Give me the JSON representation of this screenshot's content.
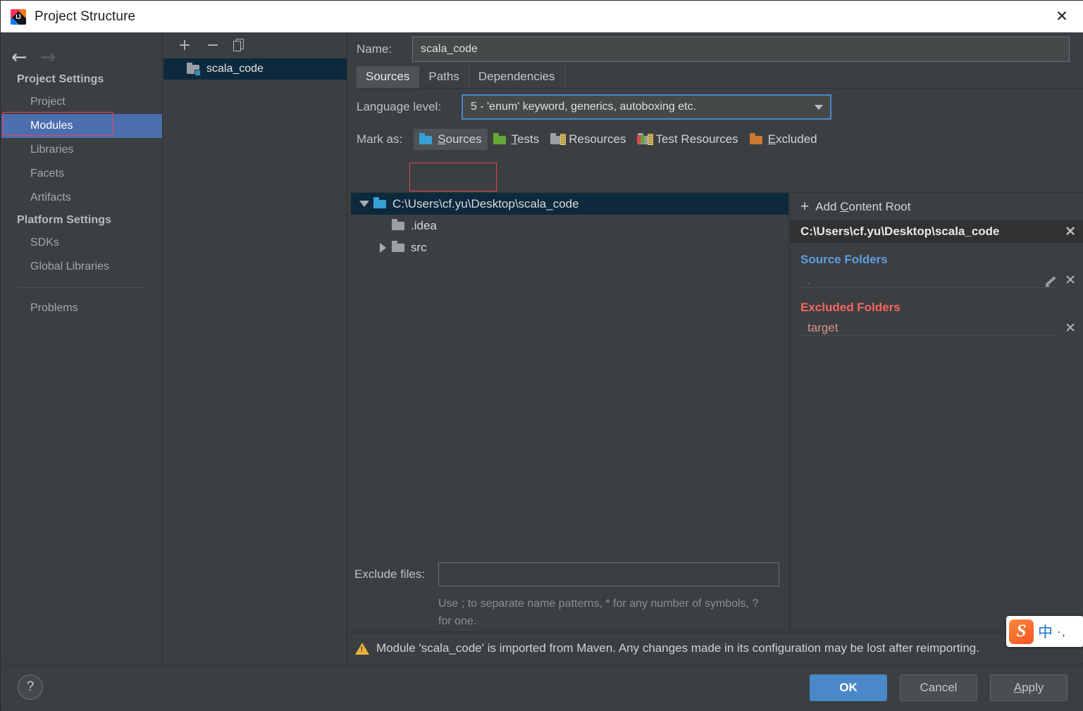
{
  "window": {
    "title": "Project Structure",
    "app_icon": "intellij-idea-icon",
    "close_label": "✕"
  },
  "sidebar": {
    "back_arrow": "←",
    "forward_arrow": "→",
    "groups": [
      {
        "title": "Project Settings",
        "items": [
          {
            "label": "Project",
            "selected": false
          },
          {
            "label": "Modules",
            "selected": true
          },
          {
            "label": "Libraries",
            "selected": false
          },
          {
            "label": "Facets",
            "selected": false
          },
          {
            "label": "Artifacts",
            "selected": false
          }
        ]
      },
      {
        "title": "Platform Settings",
        "items": [
          {
            "label": "SDKs",
            "selected": false
          },
          {
            "label": "Global Libraries",
            "selected": false
          }
        ]
      }
    ],
    "problems": {
      "label": "Problems"
    },
    "highlight_color": "#e8425a"
  },
  "module_panel": {
    "toolbar": {
      "add_label": "+",
      "remove_label": "−",
      "copy_label": "copy-icon"
    },
    "modules": [
      {
        "label": "scala_code",
        "selected": true
      }
    ]
  },
  "main": {
    "name_label": "Name:",
    "name_value": "scala_code",
    "tabs": [
      {
        "label": "Sources",
        "active": true
      },
      {
        "label": "Paths",
        "active": false
      },
      {
        "label": "Dependencies",
        "active": false
      }
    ],
    "language_level": {
      "label": "Language level:",
      "value": "5 - 'enum' keyword, generics, autoboxing etc."
    },
    "mark_as": {
      "label": "Mark as:",
      "options": [
        {
          "label": "Sources",
          "mnemonic": "S",
          "rest": "ources",
          "color": "blue",
          "active": true,
          "icon": "folder-blue-icon"
        },
        {
          "label": "Tests",
          "mnemonic": "T",
          "rest": "ests",
          "color": "green",
          "active": false,
          "icon": "folder-green-icon"
        },
        {
          "label": "Resources",
          "mnemonic": "",
          "rest": "Resources",
          "color": "gray",
          "active": false,
          "icon": "folder-resources-icon"
        },
        {
          "label": "Test Resources",
          "mnemonic": "",
          "rest": "Test Resources",
          "color": "gray",
          "active": false,
          "icon": "folder-test-resources-icon"
        },
        {
          "label": "Excluded",
          "mnemonic": "E",
          "rest": "xcluded",
          "color": "orange",
          "active": false,
          "icon": "folder-orange-icon"
        }
      ]
    },
    "tree": [
      {
        "label": "C:\\Users\\cf.yu\\Desktop\\scala_code",
        "depth": 0,
        "twisty": "down",
        "selected": true,
        "icon": "folder-blue-icon"
      },
      {
        "label": ".idea",
        "depth": 1,
        "twisty": "none",
        "selected": false,
        "icon": "folder-gray-icon"
      },
      {
        "label": "src",
        "depth": 1,
        "twisty": "right",
        "selected": false,
        "icon": "folder-gray-icon"
      }
    ],
    "exclude_files": {
      "label": "Exclude files:",
      "value": "",
      "hint": "Use ; to separate name patterns, * for any number of symbols, ? for one."
    },
    "warning": "Module 'scala_code' is imported from Maven. Any changes made in its configuration may be lost after reimporting."
  },
  "content_root": {
    "add_label_prefix": "Add ",
    "add_label_mnemonic": "C",
    "add_label_rest": "ontent Root",
    "path": "C:\\Users\\cf.yu\\Desktop\\scala_code",
    "remove_label": "✕",
    "sections": [
      {
        "title": "Source Folders",
        "color": "#5f9ee3",
        "entries": [
          {
            "name": ".",
            "dim": true,
            "has_edit": true,
            "remove_label": "✕"
          }
        ]
      },
      {
        "title": "Excluded Folders",
        "color": "#f4655e",
        "entries": [
          {
            "name": "target",
            "dim": false,
            "has_edit": false,
            "remove_label": "✕"
          }
        ]
      }
    ]
  },
  "footer": {
    "help_label": "?",
    "buttons": [
      {
        "label": "OK",
        "primary": true,
        "mnemonic": ""
      },
      {
        "label": "Cancel",
        "primary": false,
        "mnemonic": ""
      },
      {
        "label": "Apply",
        "primary": false,
        "mnemonic": "A"
      }
    ]
  },
  "ime": {
    "logo": "S",
    "mode": "中",
    "dots": "·,"
  }
}
